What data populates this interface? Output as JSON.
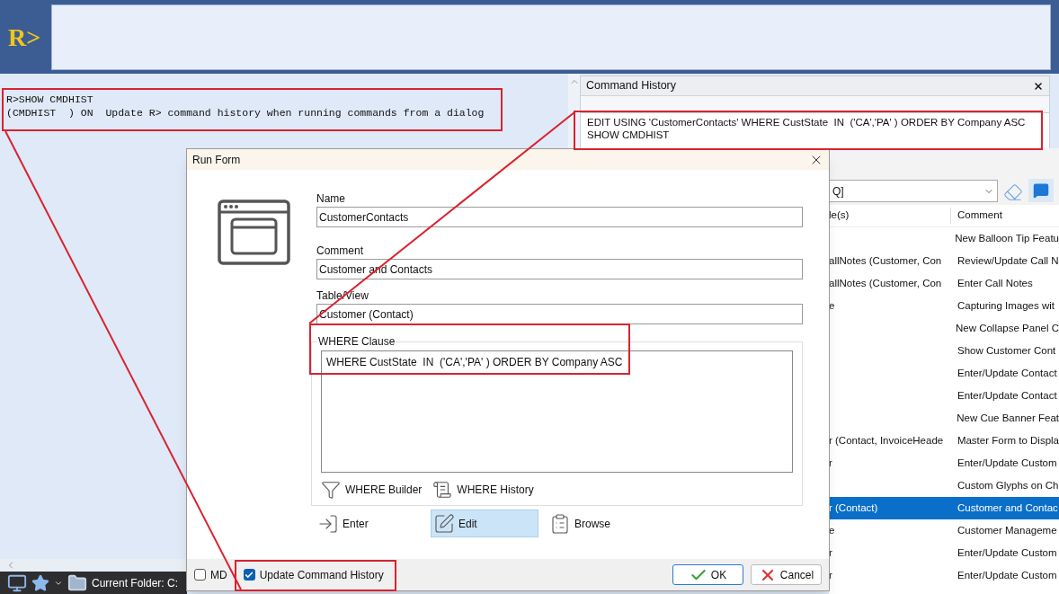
{
  "app": {
    "logo": "R>"
  },
  "console": {
    "lines": [
      "R>SHOW CMDHIST",
      "(CMDHIST  ) ON  Update R> command history when running commands from a dialog"
    ]
  },
  "command_history": {
    "title": "Command History",
    "entries": [
      "EDIT USING 'CustomerContacts' WHERE CustState  IN  ('CA','PA' ) ORDER BY Company ASC",
      "SHOW CMDHIST"
    ]
  },
  "forms_list": {
    "filter": {
      "value": "Q]"
    },
    "columns": [
      "le(s)",
      "Comment"
    ],
    "rows": [
      {
        "cells": [
          "",
          "New Balloon Tip Featu"
        ],
        "selected": false
      },
      {
        "cells": [
          "allNotes (Customer, Con",
          "Review/Update Call N"
        ],
        "selected": false
      },
      {
        "cells": [
          "allNotes (Customer, Con",
          "Enter Call Notes"
        ],
        "selected": false
      },
      {
        "cells": [
          "e",
          "Capturing Images wit"
        ],
        "selected": false
      },
      {
        "cells": [
          "",
          "New Collapse Panel C"
        ],
        "selected": false
      },
      {
        "cells": [
          "",
          "Show Customer Cont"
        ],
        "selected": false
      },
      {
        "cells": [
          "",
          "Enter/Update Contact"
        ],
        "selected": false
      },
      {
        "cells": [
          "",
          "Enter/Update Contact"
        ],
        "selected": false
      },
      {
        "cells": [
          "",
          "New Cue Banner Feat"
        ],
        "selected": false
      },
      {
        "cells": [
          "r (Contact, InvoiceHeade",
          "Master Form to Displa"
        ],
        "selected": false
      },
      {
        "cells": [
          "r",
          "Enter/Update Custom"
        ],
        "selected": false
      },
      {
        "cells": [
          "",
          "Custom Glyphs on Ch"
        ],
        "selected": false
      },
      {
        "cells": [
          "r (Contact)",
          "Customer and Contac"
        ],
        "selected": true
      },
      {
        "cells": [
          "e",
          "Customer Manageme"
        ],
        "selected": false
      },
      {
        "cells": [
          "r",
          "Enter/Update Custom"
        ],
        "selected": false
      },
      {
        "cells": [
          "r",
          "Enter/Update Custom"
        ],
        "selected": false
      }
    ]
  },
  "status_bar": {
    "folder": "Current Folder: C:"
  },
  "dialog": {
    "title": "Run Form",
    "fields": [
      {
        "label": "Name",
        "value": "CustomerContacts"
      },
      {
        "label": "Comment",
        "value": "Customer and Contacts"
      },
      {
        "label": "Table/View",
        "value": "Customer (Contact)"
      }
    ],
    "where_clause": {
      "label": "WHERE Clause",
      "value": "WHERE CustState  IN  ('CA','PA' ) ORDER BY Company ASC"
    },
    "where_tools": [
      {
        "label": "WHERE Builder",
        "kind": "builder"
      },
      {
        "label": "WHERE History",
        "kind": "history"
      }
    ],
    "actions": [
      {
        "label": "Enter",
        "kind": "enter",
        "selected": false
      },
      {
        "label": "Edit",
        "kind": "edit",
        "selected": true
      },
      {
        "label": "Browse",
        "kind": "browse",
        "selected": false
      }
    ],
    "options": [
      {
        "label": "MD",
        "checked": false
      },
      {
        "label": "Update Command History",
        "checked": true
      }
    ],
    "buttons": [
      {
        "label": "OK",
        "kind": "ok"
      },
      {
        "label": "Cancel",
        "kind": "cancel"
      }
    ]
  }
}
